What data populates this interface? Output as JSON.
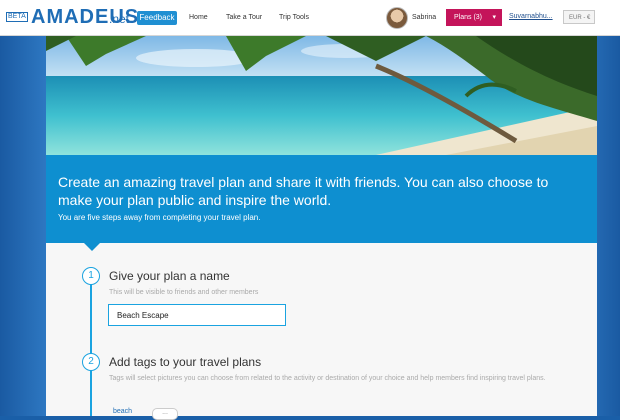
{
  "header": {
    "beta_label": "BETA",
    "logo_text": "amadeus",
    "logo_suffix": ".net",
    "feedback_label": "Feedback",
    "nav": [
      "Home",
      "Take a Tour",
      "Trip Tools"
    ],
    "user_name": "Sabrina",
    "plans_label": "Plans (3)",
    "plans_chevron": "▾",
    "user_link": "Suvarnabhu...",
    "currency": "EUR - €"
  },
  "banner": {
    "title": "Create an amazing travel plan and share it with friends. You can also choose to make your plan public and inspire the world.",
    "subtitle": "You are five steps away from completing your travel plan."
  },
  "steps": [
    {
      "number": "1",
      "title": "Give your plan a name",
      "help": "This will be visible to friends and other members",
      "input_value": "Beach Escape"
    },
    {
      "number": "2",
      "title": "Add tags to your travel plans",
      "help": "Tags will select pictures you can choose from related to the activity or destination of your choice and help members find inspiring travel plans.",
      "tags": [
        "beach"
      ],
      "more_label": "..."
    }
  ],
  "colors": {
    "brand_blue": "#1f6db5",
    "banner_blue": "#0e8fd0",
    "plans_magenta": "#c4145a"
  }
}
